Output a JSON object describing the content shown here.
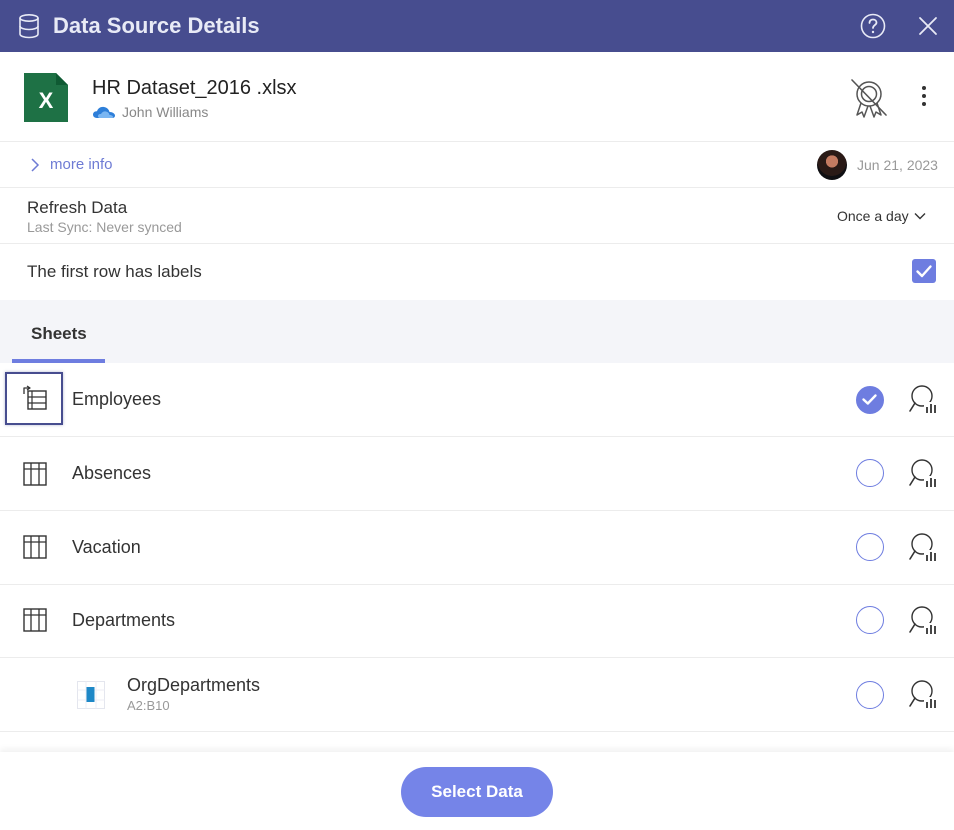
{
  "header": {
    "title": "Data Source Details",
    "icons": {
      "left": "database-icon",
      "help": "help-icon",
      "close": "close-icon"
    }
  },
  "file": {
    "name": "HR Dataset_2016 .xlsx",
    "owner": "John Williams",
    "file_icon": "excel-icon",
    "owner_icon": "onedrive-cloud-icon",
    "certification_icon": "uncertified-badge-icon",
    "menu_icon": "kebab-menu-icon"
  },
  "info": {
    "more_info_label": "more info",
    "date": "Jun 21, 2023"
  },
  "refresh": {
    "title": "Refresh Data",
    "subtitle": "Last Sync: Never synced",
    "frequency": "Once a day"
  },
  "labels_option": {
    "text": "The first row has labels",
    "checked": true
  },
  "tabs": {
    "sheets_label": "Sheets"
  },
  "sheets": [
    {
      "label": "Employees",
      "selected": true
    },
    {
      "label": "Absences",
      "selected": false
    },
    {
      "label": "Vacation",
      "selected": false
    },
    {
      "label": "Departments",
      "selected": false
    }
  ],
  "ranges": [
    {
      "label": "OrgDepartments",
      "range": "A2:B10",
      "selected": false
    }
  ],
  "footer": {
    "select_label": "Select Data"
  },
  "colors": {
    "header_bg": "#474d8f",
    "accent": "#6e7de0",
    "button": "#7584e8",
    "excel_green": "#1e7145"
  }
}
